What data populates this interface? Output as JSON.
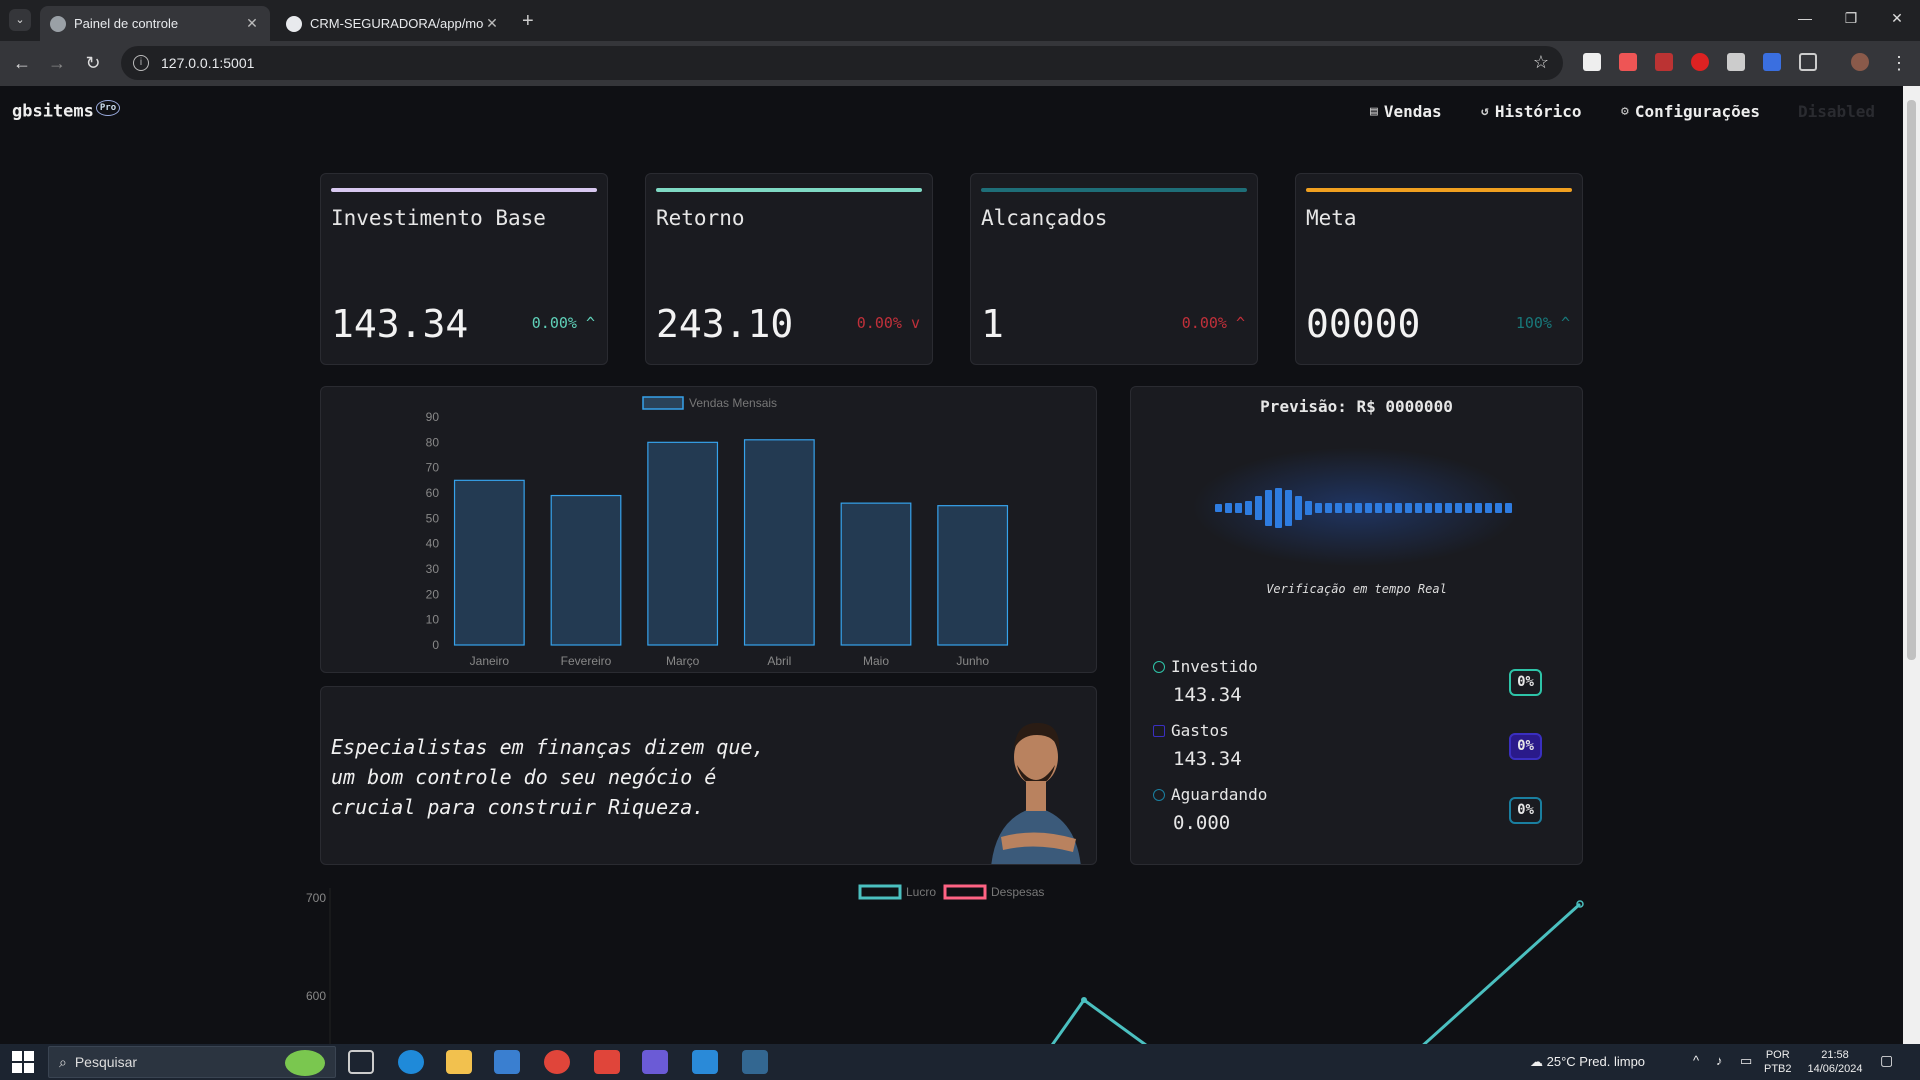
{
  "browser": {
    "tabs": [
      {
        "title": "Painel de controle",
        "active": true
      },
      {
        "title": "CRM-SEGURADORA/app/mode",
        "active": false
      }
    ],
    "url": "127.0.0.1:5001"
  },
  "header": {
    "brand": "gbsitems",
    "badge": "Pro",
    "nav": [
      {
        "label": "Vendas",
        "icon": "table-icon"
      },
      {
        "label": "Histórico",
        "icon": "history-icon"
      },
      {
        "label": "Configurações",
        "icon": "gear-icon"
      },
      {
        "label": "Disabled",
        "icon": ""
      }
    ]
  },
  "stats": [
    {
      "label": "Investimento Base",
      "value": "143.34",
      "delta": "0.00%",
      "direction": "up",
      "accent": "#d8c8f0",
      "delta_color": "#5fd0b8"
    },
    {
      "label": "Retorno",
      "value": "243.10",
      "delta": "0.00%",
      "direction": "down",
      "accent": "#7fd9c4",
      "delta_color": "#c0303a"
    },
    {
      "label": "Alcançados",
      "value": "1",
      "delta": "0.00%",
      "direction": "up",
      "accent": "#1e6e78",
      "delta_color": "#c0303a"
    },
    {
      "label": "Meta",
      "value": "00000",
      "delta": "100%",
      "direction": "up",
      "accent": "#f0a020",
      "delta_color": "#18787a"
    }
  ],
  "chart_data": [
    {
      "type": "bar",
      "categories": [
        "Janeiro",
        "Fevereiro",
        "Março",
        "Abril",
        "Maio",
        "Junho"
      ],
      "series": [
        {
          "name": "Vendas Mensais",
          "values": [
            65,
            59,
            80,
            81,
            56,
            55
          ]
        }
      ],
      "ylim": [
        0,
        90
      ],
      "yticks": [
        0,
        10,
        20,
        30,
        40,
        50,
        60,
        70,
        80,
        90
      ],
      "color": "#36a2eb",
      "legend": "top"
    },
    {
      "type": "line",
      "series": [
        {
          "name": "Lucro",
          "color": "#4bc0c0"
        },
        {
          "name": "Despesas",
          "color": "#ff6384"
        }
      ],
      "yticks_visible": [
        700,
        600
      ],
      "legend": "top"
    }
  ],
  "forecast": {
    "title": "Previsão: R$ 0000000",
    "subtitle": "Verificação em tempo Real",
    "rows": [
      {
        "label": "Investido",
        "value": "143.34",
        "pct": "0%",
        "color": "#2ec4a8"
      },
      {
        "label": "Gastos",
        "value": "143.34",
        "pct": "0%",
        "color": "#3a2fc0"
      },
      {
        "label": "Aguardando",
        "value": "0.000",
        "pct": "0%",
        "color": "#1a7fa0"
      }
    ]
  },
  "quote": {
    "lines": [
      "Especialistas em finanças dizem que,",
      "um bom controle do seu negócio é",
      "crucial para construir Riqueza."
    ]
  },
  "taskbar": {
    "search_placeholder": "Pesquisar",
    "weather": "25°C  Pred. limpo",
    "lang": "POR",
    "layout": "PTB2",
    "time": "21:58",
    "date": "14/06/2024"
  }
}
